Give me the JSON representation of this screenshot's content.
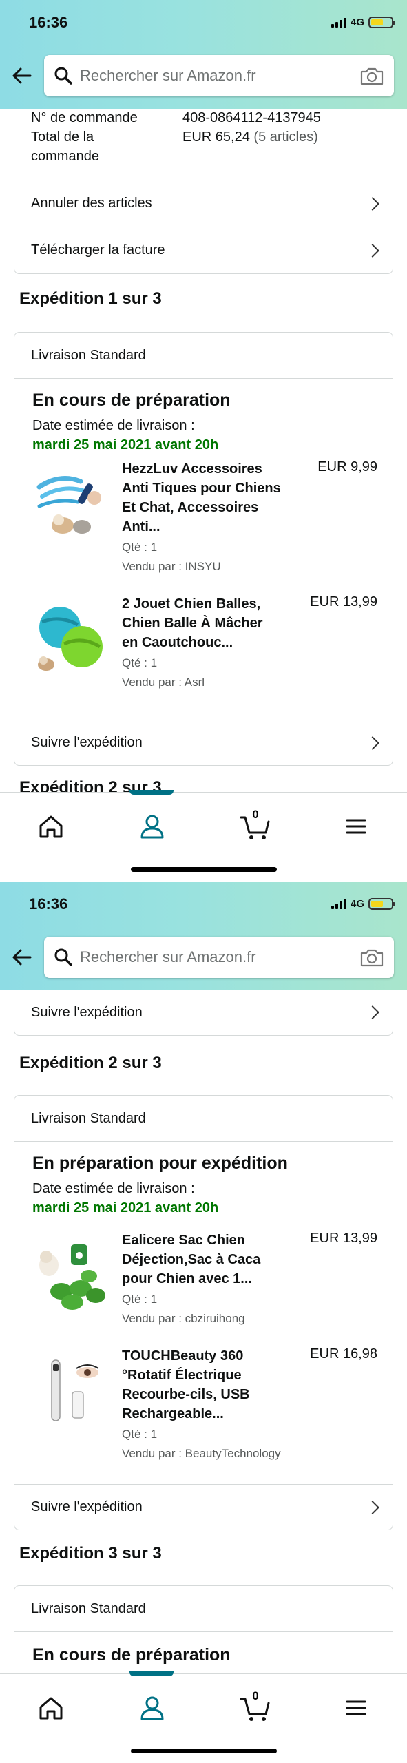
{
  "status_bar": {
    "time": "16:36",
    "network": "4G"
  },
  "search": {
    "placeholder": "Rechercher sur Amazon.fr"
  },
  "order": {
    "number_label": "N° de commande",
    "number_value": "408-0864112-4137945",
    "total_label_line1": "Total de la",
    "total_label_line2": "commande",
    "total_value": "EUR 65,24",
    "total_count": "(5 articles)"
  },
  "actions": {
    "cancel": "Annuler des articles",
    "invoice": "Télécharger la facture"
  },
  "shipment1": {
    "title": "Expédition 1 sur 3",
    "method": "Livraison Standard",
    "status": "En cours de préparation",
    "date_label": "Date estimée de livraison :",
    "date_value": "mardi 25 mai 2021 avant 20h",
    "track": "Suivre l'expédition",
    "items": [
      {
        "name_l1": "HezzLuv Accessoires",
        "name_l2": "Anti Tiques pour Chiens",
        "name_l3": "Et Chat, Accessoires",
        "name_l4": "Anti...",
        "price": "EUR 9,99",
        "qty": "Qté : 1",
        "seller": "Vendu par : INSYU"
      },
      {
        "name_l1": "2 Jouet Chien Balles,",
        "name_l2": "Chien Balle À Mâcher",
        "name_l3": "en Caoutchouc...",
        "price": "EUR 13,99",
        "qty": "Qté : 1",
        "seller": "Vendu par : Asrl"
      }
    ]
  },
  "shipment2": {
    "title": "Expédition 2 sur 3",
    "method": "Livraison Standard",
    "status": "En préparation pour expédition",
    "date_label": "Date estimée de livraison :",
    "date_value": "mardi 25 mai 2021 avant 20h",
    "track": "Suivre l'expédition",
    "items": [
      {
        "name_l1": "Ealicere Sac Chien",
        "name_l2": "Déjection,Sac à Caca",
        "name_l3": "pour Chien avec 1...",
        "price": "EUR 13,99",
        "qty": "Qté : 1",
        "seller": "Vendu par : cbziruihong"
      },
      {
        "name_l1": "TOUCHBeauty 360",
        "name_l2": "°Rotatif Électrique",
        "name_l3": "Recourbe-cils, USB",
        "name_l4": "Rechargeable...",
        "price": "EUR 16,98",
        "qty": "Qté : 1",
        "seller": "Vendu par : BeautyTechnology"
      }
    ]
  },
  "shipment3": {
    "title": "Expédition 3 sur 3",
    "method": "Livraison Standard",
    "status": "En cours de préparation"
  },
  "tabbar": {
    "cart_count": "0"
  },
  "colors": {
    "accent": "#007185",
    "delivery_date": "#007600",
    "header_gradient_start": "#8edce4",
    "header_gradient_end": "#a9e5cc"
  }
}
